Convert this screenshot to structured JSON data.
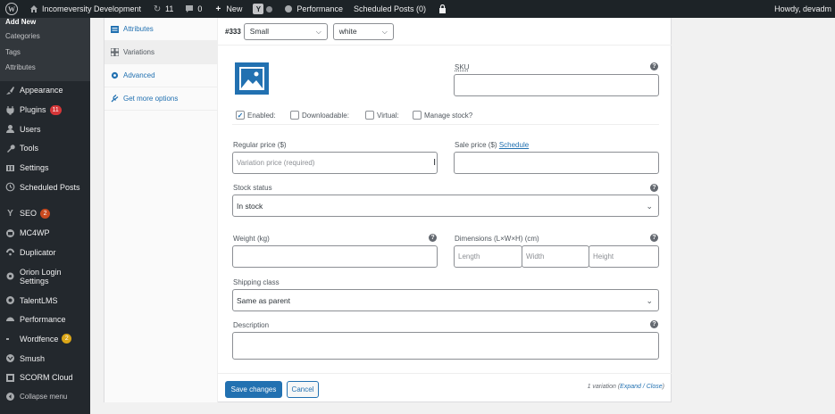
{
  "adminbar": {
    "site_name": "Incomeversity Development",
    "updates_count": "11",
    "comments_count": "0",
    "new_label": "New",
    "performance_label": "Performance",
    "scheduled_label": "Scheduled Posts (0)",
    "howdy": "Howdy, devadm"
  },
  "sidebar": {
    "submenu": {
      "current": "Add New",
      "items": [
        "Categories",
        "Tags",
        "Attributes"
      ]
    },
    "items": [
      {
        "label": "Appearance"
      },
      {
        "label": "Plugins",
        "badge": "11"
      },
      {
        "label": "Users"
      },
      {
        "label": "Tools"
      },
      {
        "label": "Settings"
      },
      {
        "label": "Scheduled Posts"
      },
      {
        "label": "SEO",
        "badge": "2"
      },
      {
        "label": "MC4WP"
      },
      {
        "label": "Duplicator"
      },
      {
        "label": "Orion Login Settings"
      },
      {
        "label": "TalentLMS"
      },
      {
        "label": "Performance"
      },
      {
        "label": "Wordfence",
        "badge": "2"
      },
      {
        "label": "Smush"
      },
      {
        "label": "SCORM Cloud"
      },
      {
        "label": "Collapse menu"
      }
    ]
  },
  "tabs": [
    "Attributes",
    "Variations",
    "Advanced",
    "Get more options"
  ],
  "variation": {
    "id": "#333",
    "size_value": "Small",
    "color_value": "white",
    "sku_label": "SKU",
    "sku_value": "",
    "checkboxes": [
      {
        "label": "Enabled:",
        "checked": true
      },
      {
        "label": "Downloadable:",
        "checked": false
      },
      {
        "label": "Virtual:",
        "checked": false
      },
      {
        "label": "Manage stock?",
        "checked": false
      }
    ],
    "regular_price_label": "Regular price ($)",
    "regular_price_placeholder": "Variation price (required)",
    "sale_price_label": "Sale price ($)",
    "schedule_link": "Schedule",
    "stock_status_label": "Stock status",
    "stock_status_value": "In stock",
    "weight_label": "Weight (kg)",
    "dimensions_label": "Dimensions (L×W×H) (cm)",
    "length_placeholder": "Length",
    "width_placeholder": "Width",
    "height_placeholder": "Height",
    "shipping_label": "Shipping class",
    "shipping_value": "Same as parent",
    "description_label": "Description"
  },
  "footer": {
    "save_label": "Save changes",
    "cancel_label": "Cancel",
    "count_text": "1 variation (",
    "expand_label": "Expand",
    "sep": " / ",
    "close_label": "Close",
    "end": ")"
  }
}
